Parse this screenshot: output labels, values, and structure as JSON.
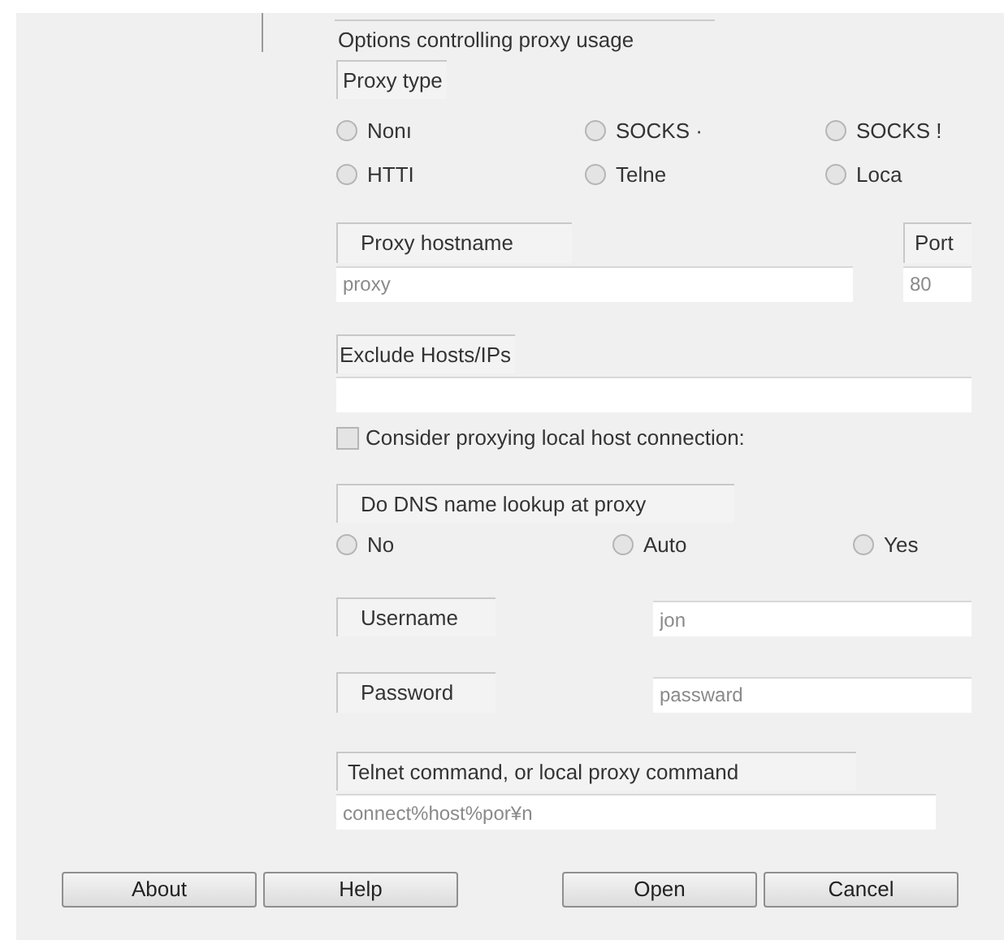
{
  "group_title": "Options controlling proxy usage",
  "proxy_type": {
    "label": "Proxy type",
    "options": [
      {
        "label": "Nonı",
        "selected": false
      },
      {
        "label": "SOCKS ·",
        "selected": false
      },
      {
        "label": "SOCKS !",
        "selected": false
      },
      {
        "label": "HTTI",
        "selected": false
      },
      {
        "label": "Telne",
        "selected": false
      },
      {
        "label": "Loca",
        "selected": false
      }
    ]
  },
  "hostname": {
    "label": "Proxy hostname",
    "value": "proxy"
  },
  "port": {
    "label": "Port",
    "value": "80"
  },
  "exclude": {
    "label": "Exclude Hosts/IPs"
  },
  "local_host": {
    "label": "Consider proxying local host connection:",
    "checked": false
  },
  "dns": {
    "label": "Do DNS name lookup at proxy",
    "options": [
      {
        "label": "No",
        "selected": false
      },
      {
        "label": "Auto",
        "selected": false
      },
      {
        "label": "Yes",
        "selected": false
      }
    ]
  },
  "username": {
    "label": "Username",
    "value": "jon"
  },
  "password": {
    "label": "Password",
    "value": "passward"
  },
  "command": {
    "label": "Telnet command, or local proxy command",
    "value": "connect%host%por¥n"
  },
  "buttons": [
    "About",
    "Help",
    "Open",
    "Cancel"
  ]
}
